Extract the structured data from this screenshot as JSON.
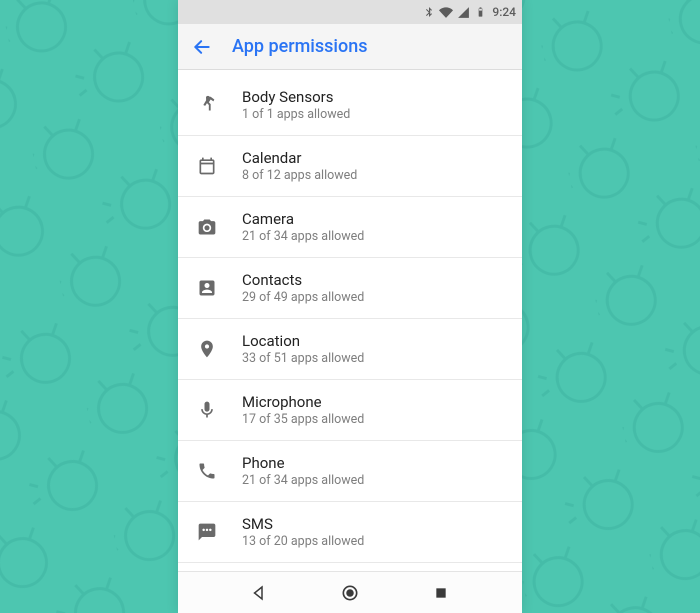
{
  "statusbar": {
    "time": "9:24"
  },
  "appbar": {
    "title": "App permissions"
  },
  "permissions": [
    {
      "icon": "body-sensors",
      "title": "Body Sensors",
      "subtitle": "1 of 1 apps allowed"
    },
    {
      "icon": "calendar",
      "title": "Calendar",
      "subtitle": "8 of 12 apps allowed"
    },
    {
      "icon": "camera",
      "title": "Camera",
      "subtitle": "21 of 34 apps allowed"
    },
    {
      "icon": "contacts",
      "title": "Contacts",
      "subtitle": "29 of 49 apps allowed"
    },
    {
      "icon": "location",
      "title": "Location",
      "subtitle": "33 of 51 apps allowed"
    },
    {
      "icon": "microphone",
      "title": "Microphone",
      "subtitle": "17 of 35 apps allowed"
    },
    {
      "icon": "phone",
      "title": "Phone",
      "subtitle": "21 of 34 apps allowed"
    },
    {
      "icon": "sms",
      "title": "SMS",
      "subtitle": "13 of 20 apps allowed"
    }
  ]
}
